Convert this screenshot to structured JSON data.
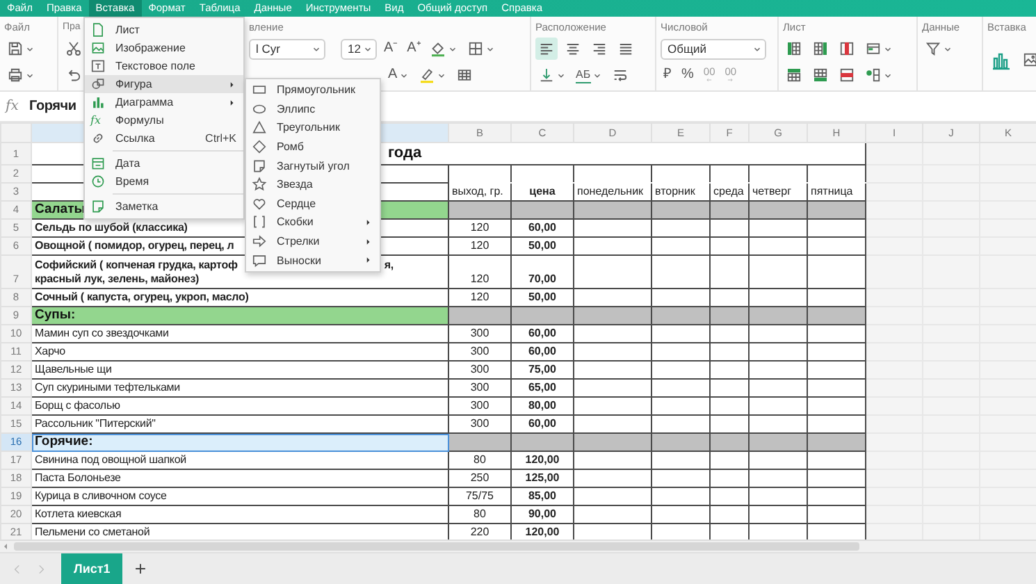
{
  "menu_bar": {
    "items": [
      {
        "label": "Файл",
        "selected": false
      },
      {
        "label": "Правка",
        "selected": false
      },
      {
        "label": "Вставка",
        "selected": true
      },
      {
        "label": "Формат",
        "selected": false
      },
      {
        "label": "Таблица",
        "selected": false
      },
      {
        "label": "Данные",
        "selected": false
      },
      {
        "label": "Инструменты",
        "selected": false
      },
      {
        "label": "Вид",
        "selected": false
      },
      {
        "label": "Общий доступ",
        "selected": false
      },
      {
        "label": "Справка",
        "selected": false
      }
    ]
  },
  "ribbon": {
    "groups": [
      {
        "label": "Файл",
        "top": [
          {
            "kind": "save",
            "caret": true
          }
        ],
        "bottom": [
          {
            "kind": "print",
            "caret": true
          }
        ]
      },
      {
        "label": "Пра",
        "top": [
          {
            "kind": "cut"
          }
        ],
        "bottom": [
          {
            "kind": "undo"
          }
        ]
      },
      {
        "label": "вление",
        "top": [
          {
            "kind": "font_field",
            "value": "l Cyr"
          },
          {
            "kind": "size_field",
            "value": "12"
          },
          {
            "kind": "font_size_down",
            "label": "A⁻"
          },
          {
            "kind": "font_size_up",
            "label": "A⁺"
          },
          {
            "kind": "fill",
            "caret": true
          },
          {
            "kind": "borders",
            "caret": true
          }
        ],
        "bottom": [
          {
            "kind": "font_color",
            "label": "A",
            "caret": true
          },
          {
            "kind": "highlighter",
            "caret": true
          },
          {
            "kind": "table"
          }
        ]
      },
      {
        "label": "Расположение",
        "top": [
          {
            "kind": "align_left",
            "selected": true
          },
          {
            "kind": "align_center",
            "selected": false
          },
          {
            "kind": "align_right",
            "selected": false
          },
          {
            "kind": "justify",
            "selected": false
          }
        ],
        "bottom": [
          {
            "kind": "valign_bottom",
            "caret": true
          },
          {
            "kind": "text_direction",
            "label": "АБ",
            "caret": true
          },
          {
            "kind": "wrap"
          }
        ]
      },
      {
        "label": "Числовой",
        "top": [
          {
            "kind": "format_field",
            "value": "Общий"
          }
        ],
        "bottom": [
          {
            "kind": "currency",
            "label": "₽"
          },
          {
            "kind": "percent",
            "label": "%"
          },
          {
            "kind": "decimal_decrease",
            "label": "00"
          },
          {
            "kind": "decimal_increase",
            "label": "00"
          }
        ]
      },
      {
        "label": "Лист",
        "top": [
          {
            "kind": "col_insert_left"
          },
          {
            "kind": "col_insert_right"
          },
          {
            "kind": "col_delete"
          },
          {
            "kind": "sheet_format",
            "caret": true
          }
        ],
        "bottom": [
          {
            "kind": "row_insert_above"
          },
          {
            "kind": "row_insert_below"
          },
          {
            "kind": "row_delete"
          },
          {
            "kind": "cell_props",
            "caret": true
          }
        ]
      },
      {
        "label": "Данные",
        "top": [
          {
            "kind": "filter",
            "caret": true
          }
        ]
      },
      {
        "label": "Вставка",
        "top": [
          {
            "kind": "chart"
          },
          {
            "kind": "image"
          }
        ]
      }
    ]
  },
  "formula_bar": {
    "glyph": "fx",
    "value": "Горячи"
  },
  "sheet": {
    "columns": [
      {
        "selected": true
      },
      {
        "label": "B",
        "selected": false
      },
      {
        "label": "C",
        "selected": false
      },
      {
        "label": "D",
        "selected": false
      },
      {
        "label": "E",
        "selected": false
      },
      {
        "label": "F",
        "selected": false
      },
      {
        "label": "G",
        "selected": false
      },
      {
        "label": "H",
        "selected": false
      },
      {
        "label": "I",
        "selected": false
      },
      {
        "label": "J",
        "selected": false
      },
      {
        "label": "K",
        "selected": false
      }
    ],
    "rows": [
      {
        "number": "1",
        "kind": "title",
        "title": "года",
        "selected": false
      },
      {
        "number": "2",
        "kind": "blank",
        "selected": false
      },
      {
        "number": "3",
        "kind": "header",
        "labels": [
          "выход, гр.",
          "цена",
          "понедельник",
          "вторник",
          "среда",
          "четверг",
          "пятница"
        ],
        "selected": false
      },
      {
        "number": "4",
        "kind": "section",
        "name": "Салаты",
        "selected": false
      },
      {
        "number": "5",
        "kind": "item_bold",
        "name": "Сельдь по шубой (классика)",
        "weight": "120",
        "price": "60,00",
        "selected": false
      },
      {
        "number": "6",
        "kind": "item_bold",
        "name": "Овощной ( помидор, огурец, перец, л",
        "weight": "120",
        "price": "50,00",
        "selected": false
      },
      {
        "number": "7",
        "kind": "item_bold",
        "name": "Софийский ( копченая грудка, картоф",
        "name_tail": "я,",
        "name_line2": "красный лук, зелень, майонез)",
        "weight": "120",
        "price": "70,00",
        "selected": false
      },
      {
        "number": "8",
        "kind": "item_bold",
        "name": "Сочный ( капуста, огурец, укроп, масло)",
        "weight": "120",
        "price": "50,00",
        "selected": false
      },
      {
        "number": "9",
        "kind": "section",
        "name": "Супы:",
        "selected": false
      },
      {
        "number": "10",
        "kind": "item",
        "name": "Мамин суп со звездочками",
        "weight": "300",
        "price": "60,00",
        "selected": false
      },
      {
        "number": "11",
        "kind": "item",
        "name": "Харчо",
        "weight": "300",
        "price": "60,00",
        "selected": false
      },
      {
        "number": "12",
        "kind": "item",
        "name": "Щавельные щи",
        "weight": "300",
        "price": "75,00",
        "selected": false
      },
      {
        "number": "13",
        "kind": "item",
        "name": "Суп скуриными тефтельками",
        "weight": "300",
        "price": "65,00",
        "selected": false
      },
      {
        "number": "14",
        "kind": "item",
        "name": "Борщ с фасолью",
        "weight": "300",
        "price": "80,00",
        "selected": false
      },
      {
        "number": "15",
        "kind": "item",
        "name": "Рассольник \"Питерский\"",
        "weight": "300",
        "price": "60,00",
        "selected": false
      },
      {
        "number": "16",
        "kind": "section",
        "name": "Горячие:",
        "selected": true
      },
      {
        "number": "17",
        "kind": "item",
        "name": "Свинина под овощной шапкой",
        "weight": "80",
        "price": "120,00",
        "selected": false
      },
      {
        "number": "18",
        "kind": "item",
        "name": "Паста Болоньезе",
        "weight": "250",
        "price": "125,00",
        "selected": false
      },
      {
        "number": "19",
        "kind": "item",
        "name": "Курица в сливочном соусе",
        "weight": "75/75",
        "price": "85,00",
        "selected": false
      },
      {
        "number": "20",
        "kind": "item",
        "name": "Котлета киевская",
        "weight": "80",
        "price": "90,00",
        "selected": false
      },
      {
        "number": "21",
        "kind": "item",
        "name": "Пельмени со сметаной",
        "weight": "220",
        "price": "120,00",
        "selected": false
      }
    ]
  },
  "sheet_tabs": [
    {
      "label": "Лист1",
      "selected": true
    }
  ],
  "insert_menu": {
    "items": [
      {
        "kind": "sheet",
        "label": "Лист",
        "selected": false,
        "submenu": false
      },
      {
        "kind": "image",
        "label": "Изображение",
        "selected": false,
        "submenu": false
      },
      {
        "kind": "text_box",
        "label": "Текстовое поле",
        "selected": false,
        "submenu": false
      },
      {
        "kind": "shape",
        "label": "Фигура",
        "selected": true,
        "submenu": true
      },
      {
        "kind": "chart",
        "label": "Диаграмма",
        "selected": false,
        "submenu": true
      },
      {
        "kind": "formula",
        "glyph": "fx",
        "label": "Формулы",
        "selected": false,
        "submenu": false
      },
      {
        "kind": "link",
        "label": "Ссылка",
        "shortcut": "Ctrl+K",
        "selected": false,
        "submenu": false
      },
      {
        "kind": "separator"
      },
      {
        "kind": "date",
        "label": "Дата",
        "selected": false,
        "submenu": false
      },
      {
        "kind": "time",
        "label": "Время",
        "selected": false,
        "submenu": false
      },
      {
        "kind": "separator"
      },
      {
        "kind": "note",
        "label": "Заметка",
        "selected": false,
        "submenu": false
      }
    ]
  },
  "shape_menu": {
    "items": [
      {
        "kind": "rectangle",
        "label": "Прямоугольник",
        "submenu": false
      },
      {
        "kind": "ellipse",
        "label": "Эллипс",
        "submenu": false
      },
      {
        "kind": "triangle",
        "label": "Треугольник",
        "submenu": false
      },
      {
        "kind": "diamond",
        "label": "Ромб",
        "submenu": false
      },
      {
        "kind": "folded_corner",
        "label": "Загнутый угол",
        "submenu": false
      },
      {
        "kind": "star",
        "label": "Звезда",
        "submenu": false
      },
      {
        "kind": "heart",
        "label": "Сердце",
        "submenu": false
      },
      {
        "kind": "brackets",
        "label": "Скобки",
        "submenu": true
      },
      {
        "kind": "arrow",
        "label": "Стрелки",
        "submenu": true
      },
      {
        "kind": "callout",
        "label": "Выноски",
        "submenu": true
      }
    ]
  }
}
